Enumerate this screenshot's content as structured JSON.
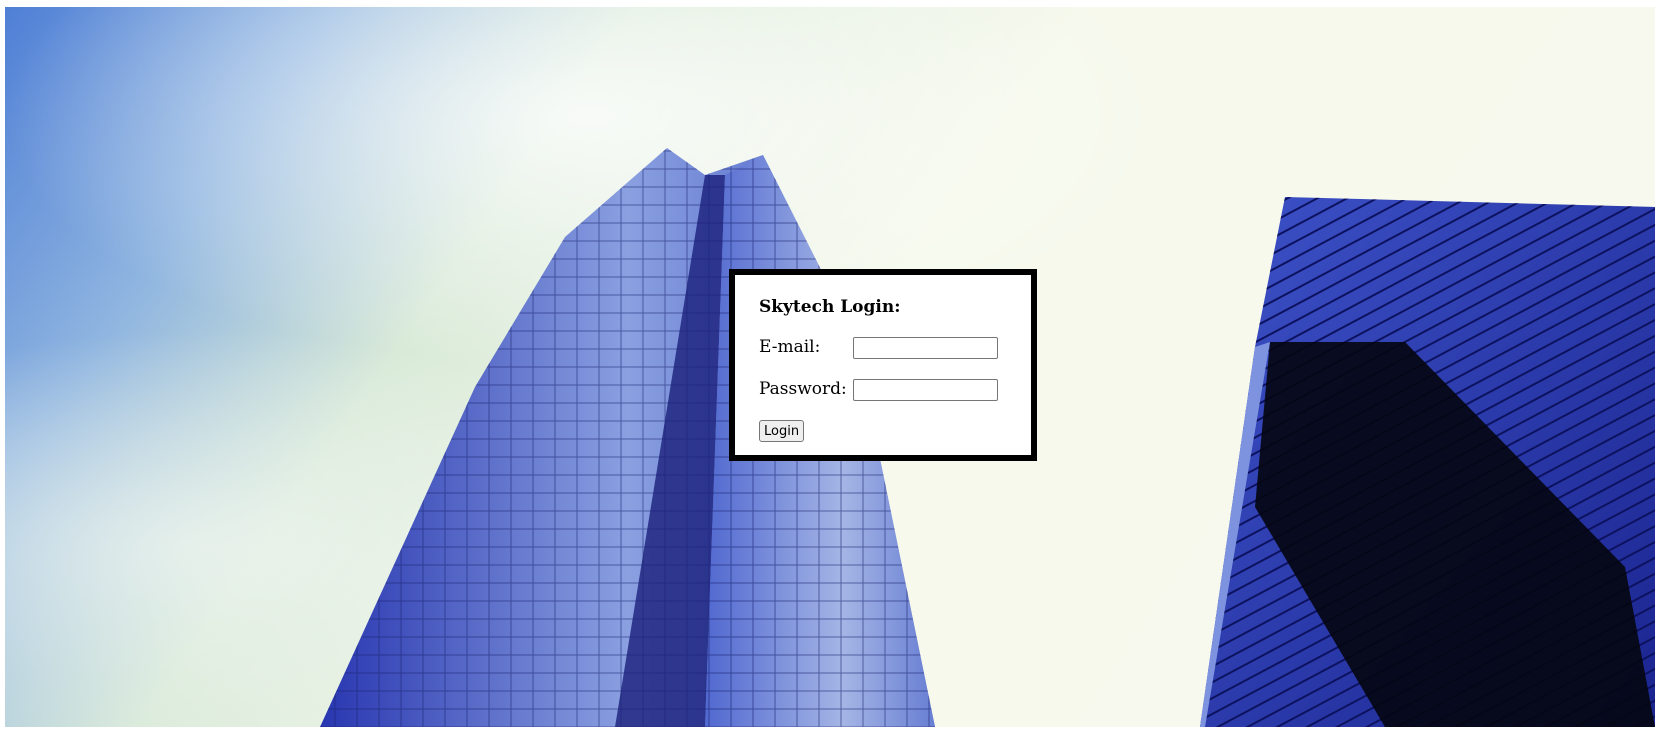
{
  "login": {
    "title": "Skytech Login:",
    "email_label": "E-mail:",
    "email_value": "",
    "password_label": "Password:",
    "password_value": "",
    "button_label": "Login"
  },
  "colors": {
    "sky_blue": "#5b86d8",
    "cloud_white": "#f7f9ee",
    "glass_blue": "#3447b8",
    "box_border": "#000000"
  }
}
